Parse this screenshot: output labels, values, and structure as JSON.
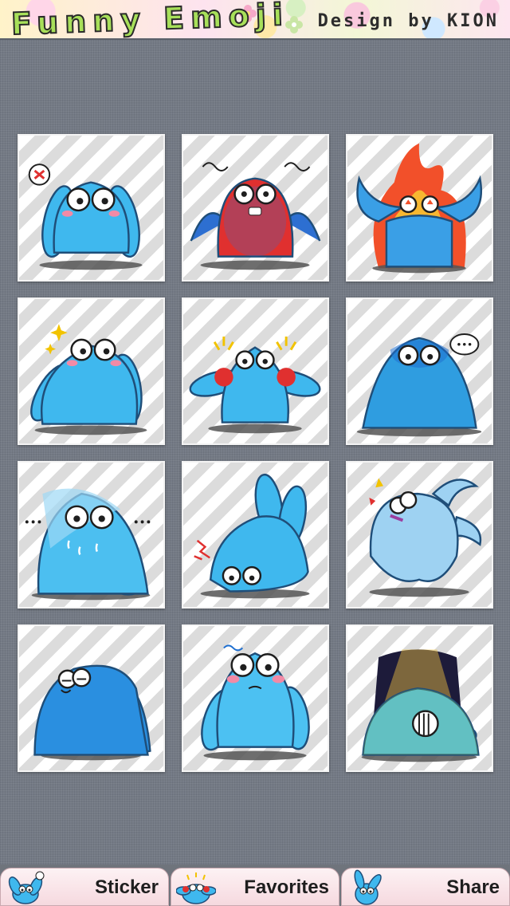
{
  "header": {
    "title": "Funny Emoji",
    "credit": "Design by KION"
  },
  "colors": {
    "background": "#747a85",
    "tile_stripe_light": "#ffffff",
    "tile_stripe_dark": "#dcdcdc",
    "character_blue": "#3fb8ee",
    "character_outline": "#1f4e79",
    "tab_background": "#f6d9df"
  },
  "stickers": [
    {
      "name": "anger-mark",
      "mood": "angry",
      "color": "#3fb8ee"
    },
    {
      "name": "red-furious",
      "mood": "furious",
      "color": "#e0302f"
    },
    {
      "name": "on-fire",
      "mood": "fired-up",
      "color": "#3a9fe6"
    },
    {
      "name": "sparkle-thinking",
      "mood": "sparkle",
      "color": "#3fb8ee"
    },
    {
      "name": "flustered",
      "mood": "flustered",
      "color": "#3fb8ee"
    },
    {
      "name": "speechless",
      "mood": "ellipsis",
      "color": "#2f9de0"
    },
    {
      "name": "sweating",
      "mood": "nervous",
      "color": "#4cbff0"
    },
    {
      "name": "bowing-down",
      "mood": "defeated",
      "color": "#3fb8ee"
    },
    {
      "name": "shocked",
      "mood": "shock",
      "color": "#9ed2f2"
    },
    {
      "name": "sulking",
      "mood": "sulk",
      "color": "#2a8fe0"
    },
    {
      "name": "shy",
      "mood": "shy",
      "color": "#4cc1f2"
    },
    {
      "name": "gloomy",
      "mood": "depressed",
      "color": "#4cb6ea"
    }
  ],
  "tabs": [
    {
      "label": "Sticker",
      "icon": "sticker-tab-icon"
    },
    {
      "label": "Favorites",
      "icon": "favorites-tab-icon"
    },
    {
      "label": "Share",
      "icon": "share-tab-icon"
    }
  ]
}
